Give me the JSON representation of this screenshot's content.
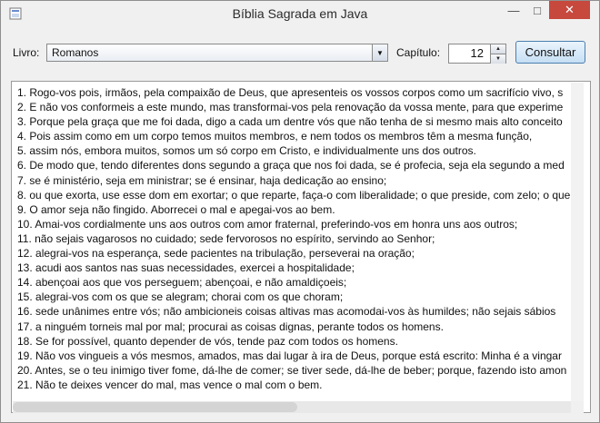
{
  "window": {
    "title": "Bíblia Sagrada em Java",
    "controls": {
      "minimize": "—",
      "maximize": "□",
      "close": "✕"
    }
  },
  "toolbar": {
    "book_label": "Livro:",
    "book_value": "Romanos",
    "chapter_label": "Capítulo:",
    "chapter_value": "12",
    "consult_label": "Consultar"
  },
  "verses": [
    "1. Rogo-vos pois, irmãos, pela compaixão de Deus, que apresenteis os vossos corpos como um sacrifício vivo, s",
    "2. E não vos conformeis a este mundo, mas transformai-vos pela renovação da vossa mente, para que experime",
    "3. Porque pela graça que me foi dada, digo a cada um dentre vós que não tenha de si mesmo mais alto conceito",
    "4. Pois assim como em um corpo temos muitos membros, e nem todos os membros têm a mesma função,",
    "5. assim nós, embora muitos, somos um só corpo em Cristo, e individualmente uns dos outros.",
    "6. De modo que, tendo diferentes dons segundo a graça que nos foi dada, se é profecia, seja ela segundo a med",
    "7. se é ministério, seja em ministrar; se é ensinar, haja dedicação ao ensino;",
    "8. ou que exorta, use esse dom em exortar; o que reparte, faça-o com liberalidade; o que preside, com zelo; o que",
    "9. O amor seja não fingido. Aborrecei o mal e apegai-vos ao bem.",
    "10. Amai-vos cordialmente uns aos outros com amor fraternal, preferindo-vos em honra uns aos outros;",
    "11. não sejais vagarosos no cuidado; sede fervorosos no espírito, servindo ao Senhor;",
    "12. alegrai-vos na esperança, sede pacientes na tribulação, perseverai na oração;",
    "13. acudi aos santos nas suas necessidades, exercei a hospitalidade;",
    "14. abençoai aos que vos perseguem; abençoai, e não amaldiçoeis;",
    "15. alegrai-vos com os que se alegram; chorai com os que choram;",
    "16. sede unânimes entre vós; não ambicioneis coisas altivas mas acomodai-vos às humildes; não sejais sábios",
    "17. a ninguém torneis mal por mal; procurai as coisas dignas, perante todos os homens.",
    "18. Se for possível, quanto depender de vós, tende paz com todos os homens.",
    "19. Não vos vingueis a vós mesmos, amados, mas dai lugar à ira de Deus, porque está escrito: Minha é a vingar",
    "20. Antes, se o teu inimigo tiver fome, dá-lhe de comer; se tiver sede, dá-lhe de beber; porque, fazendo isto amon",
    "21. Não te deixes vencer do mal, mas vence o mal com o bem."
  ],
  "scroll": {
    "horizontal_visible_fraction": 0.51,
    "vertical_visible_fraction": 1.0
  }
}
